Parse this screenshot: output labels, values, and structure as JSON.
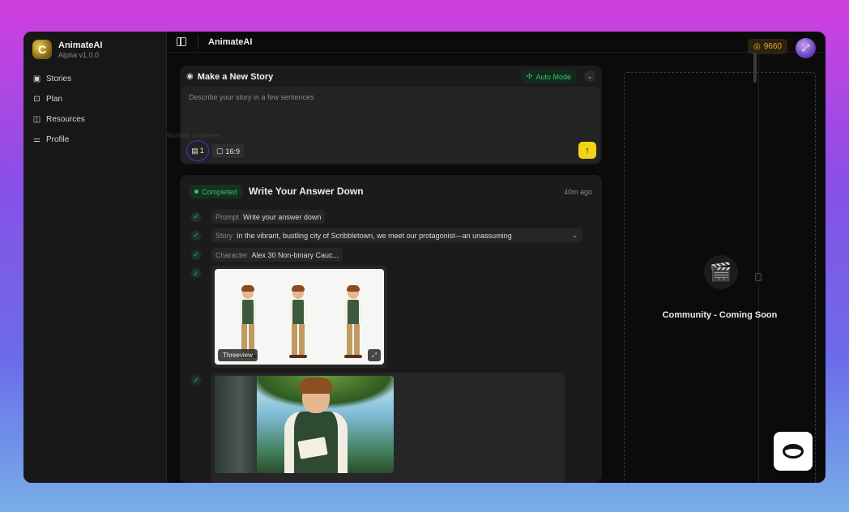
{
  "app": {
    "name": "AnimateAI",
    "version": "Alpha v1.0.0",
    "logo_letter": "C"
  },
  "sidebar": {
    "items": [
      {
        "label": "Stories",
        "icon": "image-icon"
      },
      {
        "label": "Plan",
        "icon": "briefcase-icon"
      },
      {
        "label": "Resources",
        "icon": "book-icon"
      },
      {
        "label": "Profile",
        "icon": "sliders-icon"
      }
    ]
  },
  "header": {
    "title": "AnimateAI",
    "credits": "9660"
  },
  "new_story": {
    "title": "Make a New Story",
    "mode_label": "Auto Mode",
    "placeholder": "Describe your story in a few sentences",
    "count": "1",
    "ratio": "16:9",
    "ghost_tooltip": "Number of Scenes"
  },
  "story": {
    "status": "Completed",
    "title": "Write Your Answer Down",
    "time": "40m ago",
    "prompt_key": "Prompt",
    "prompt_value": "Write your answer down",
    "story_key": "Story",
    "story_value": "In the vibrant, bustling city of Scribbletown, we meet our protagonist—an unassuming",
    "character_key": "Character",
    "character_value": "Alex 30 Non-binary Cauc...",
    "image1_label": "Threeview"
  },
  "community": {
    "label": "Community - Coming Soon"
  },
  "colors": {
    "accent_yellow": "#f4d218",
    "success_green": "#37c46a",
    "credits_orange": "#f2a81d"
  }
}
